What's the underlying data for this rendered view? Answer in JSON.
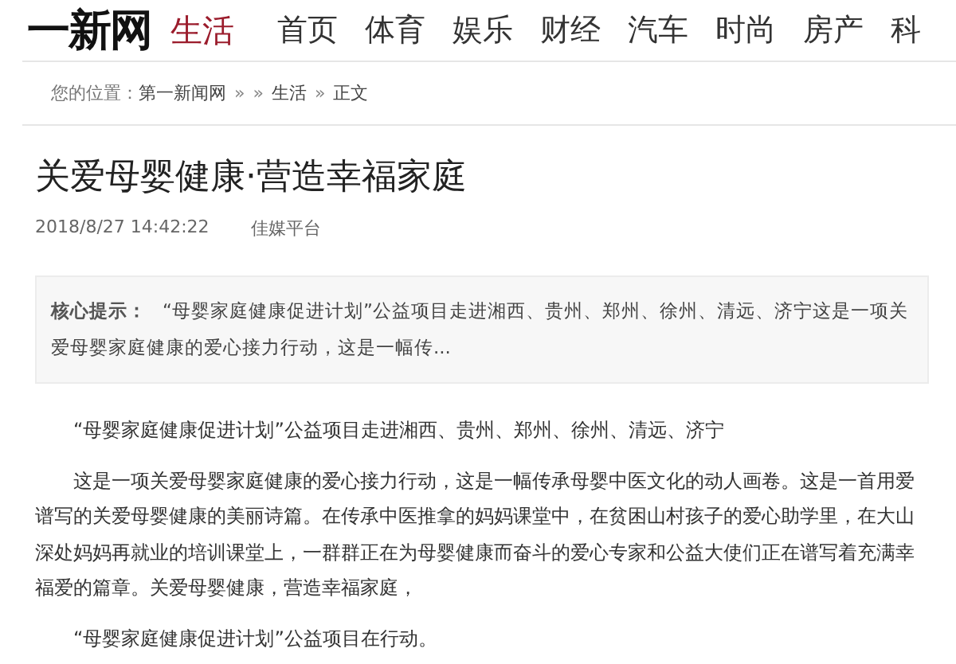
{
  "header": {
    "logo": "一新网",
    "channel": "生活",
    "nav": [
      {
        "label": "首页"
      },
      {
        "label": "体育"
      },
      {
        "label": "娱乐"
      },
      {
        "label": "财经"
      },
      {
        "label": "汽车"
      },
      {
        "label": "时尚"
      },
      {
        "label": "房产"
      },
      {
        "label": "科"
      }
    ]
  },
  "breadcrumb": {
    "label": "您的位置：",
    "items": [
      {
        "text": "第一新闻网",
        "kind": "link"
      },
      {
        "text": "»",
        "kind": "sep"
      },
      {
        "text": "»",
        "kind": "sep"
      },
      {
        "text": "生活",
        "kind": "link"
      },
      {
        "text": "»",
        "kind": "sep"
      },
      {
        "text": "正文",
        "kind": "text"
      }
    ]
  },
  "article": {
    "title": "关爱母婴健康·营造幸福家庭",
    "date": "2018/8/27 14:42:22",
    "source": "佳媒平台",
    "summary": {
      "label": "核心提示：",
      "text": "“母婴家庭健康促进计划”公益项目走进湘西、贵州、郑州、徐州、清远、济宁这是一项关爱母婴家庭健康的爱心接力行动，这是一幅传..."
    },
    "paragraphs": [
      "“母婴家庭健康促进计划”公益项目走进湘西、贵州、郑州、徐州、清远、济宁",
      "这是一项关爱母婴家庭健康的爱心接力行动，这是一幅传承母婴中医文化的动人画卷。这是一首用爱谱写的关爱母婴健康的美丽诗篇。在传承中医推拿的妈妈课堂中，在贫困山村孩子的爱心助学里，在大山深处妈妈再就业的培训课堂上，一群群正在为母婴健康而奋斗的爱心专家和公益大使们正在谱写着充满幸福爱的篇章。关爱母婴健康，营造幸福家庭，",
      "“母婴家庭健康促进计划”公益项目在行动。"
    ]
  }
}
